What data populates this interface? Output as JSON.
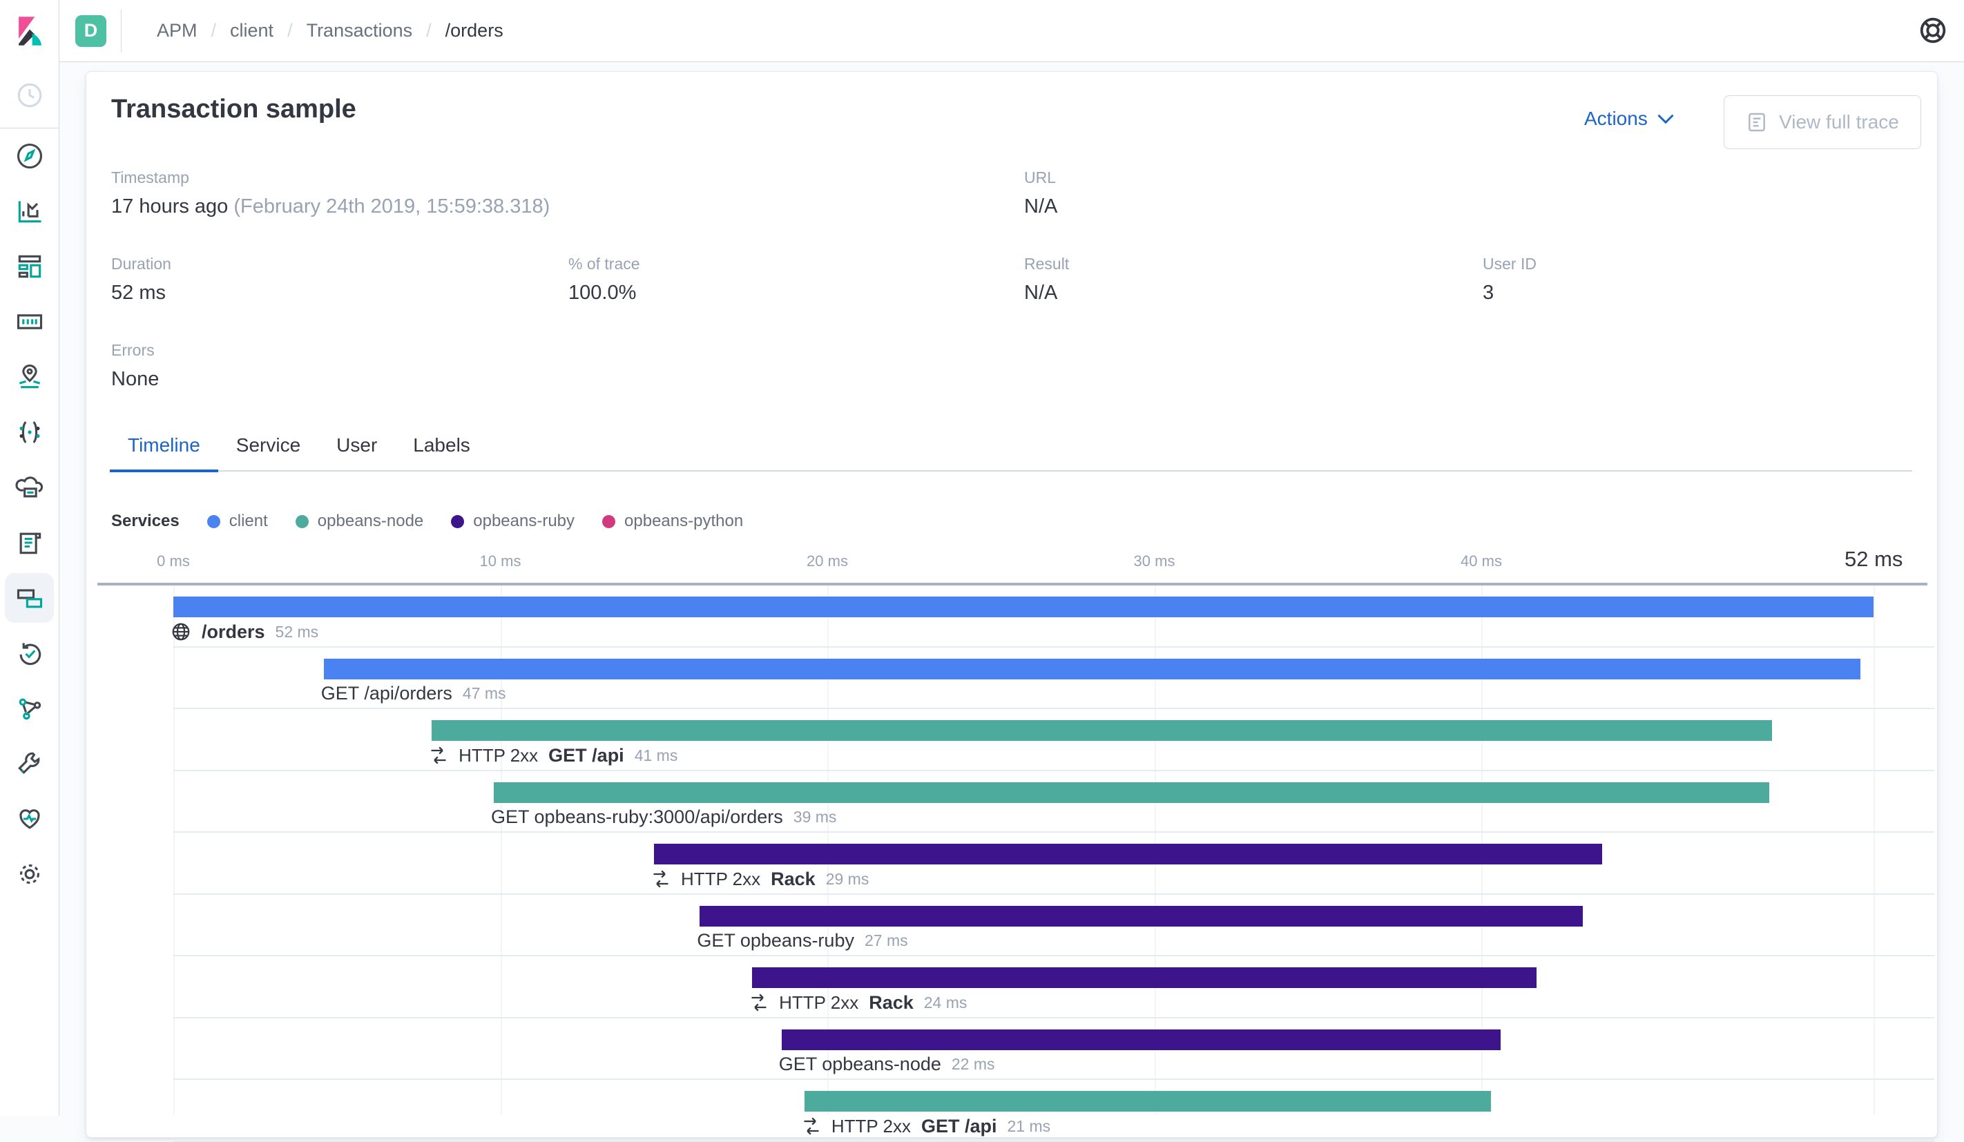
{
  "topbar": {
    "space_badge": "D",
    "breadcrumbs": [
      {
        "label": "APM"
      },
      {
        "label": "client"
      },
      {
        "label": "Transactions"
      },
      {
        "label": "/orders",
        "current": true
      }
    ]
  },
  "sidebar": {
    "items": [
      "recently-viewed",
      "discover",
      "visualize",
      "dashboard",
      "canvas",
      "maps",
      "machine-learning",
      "infrastructure",
      "logs",
      "apm",
      "uptime",
      "graph",
      "dev-tools",
      "monitoring",
      "management"
    ],
    "selected": "apm"
  },
  "header": {
    "title": "Transaction sample",
    "actions_label": "Actions",
    "view_full_trace_label": "View full trace"
  },
  "metadata": {
    "timestamp": {
      "label": "Timestamp",
      "value": "17 hours ago",
      "value_detail": "(February 24th 2019, 15:59:38.318)"
    },
    "url": {
      "label": "URL",
      "value": "N/A"
    },
    "duration": {
      "label": "Duration",
      "value": "52 ms"
    },
    "percent_of_trace": {
      "label": "% of trace",
      "value": "100.0%"
    },
    "result": {
      "label": "Result",
      "value": "N/A"
    },
    "user_id": {
      "label": "User ID",
      "value": "3"
    },
    "errors": {
      "label": "Errors",
      "value": "None"
    }
  },
  "tabs": [
    {
      "label": "Timeline",
      "active": true
    },
    {
      "label": "Service"
    },
    {
      "label": "User"
    },
    {
      "label": "Labels"
    }
  ],
  "legend": {
    "label": "Services",
    "items": [
      {
        "label": "client",
        "color": "#4A82F2"
      },
      {
        "label": "opbeans-node",
        "color": "#4DAB9E"
      },
      {
        "label": "opbeans-ruby",
        "color": "#3E148C"
      },
      {
        "label": "opbeans-python",
        "color": "#D33A7E"
      }
    ]
  },
  "timeline": {
    "axis": {
      "ticks": [
        {
          "label": "0 ms",
          "ms": 0
        },
        {
          "label": "10 ms",
          "ms": 10
        },
        {
          "label": "20 ms",
          "ms": 20
        },
        {
          "label": "30 ms",
          "ms": 30
        },
        {
          "label": "40 ms",
          "ms": 40
        }
      ],
      "total": {
        "label": "52 ms",
        "ms": 52
      }
    },
    "rows": [
      {
        "icon": "globe",
        "name": "/orders",
        "bold": true,
        "duration": "52 ms",
        "start_ms": 0,
        "duration_ms": 52,
        "service": "client"
      },
      {
        "name": "GET /api/orders",
        "duration": "47 ms",
        "start_ms": 4.6,
        "duration_ms": 47,
        "service": "client"
      },
      {
        "icon": "merge",
        "prefix": "HTTP 2xx",
        "name": "GET /api",
        "bold": true,
        "duration": "41 ms",
        "start_ms": 7.9,
        "duration_ms": 41,
        "service": "opbeans-node"
      },
      {
        "name": "GET opbeans-ruby:3000/api/orders",
        "duration": "39 ms",
        "start_ms": 9.8,
        "duration_ms": 39,
        "service": "opbeans-node"
      },
      {
        "icon": "merge",
        "prefix": "HTTP 2xx",
        "name": "Rack",
        "bold": true,
        "duration": "29 ms",
        "start_ms": 14.7,
        "duration_ms": 29,
        "service": "opbeans-ruby"
      },
      {
        "name": "GET opbeans-ruby",
        "duration": "27 ms",
        "start_ms": 16.1,
        "duration_ms": 27,
        "service": "opbeans-ruby"
      },
      {
        "icon": "merge",
        "prefix": "HTTP 2xx",
        "name": "Rack",
        "bold": true,
        "duration": "24 ms",
        "start_ms": 17.7,
        "duration_ms": 24,
        "service": "opbeans-ruby"
      },
      {
        "name": "GET opbeans-node",
        "duration": "22 ms",
        "start_ms": 18.6,
        "duration_ms": 22,
        "service": "opbeans-ruby"
      },
      {
        "icon": "merge",
        "prefix": "HTTP 2xx",
        "name": "GET /api",
        "bold": true,
        "duration": "21 ms",
        "start_ms": 19.3,
        "duration_ms": 21,
        "service": "opbeans-node"
      }
    ]
  }
}
